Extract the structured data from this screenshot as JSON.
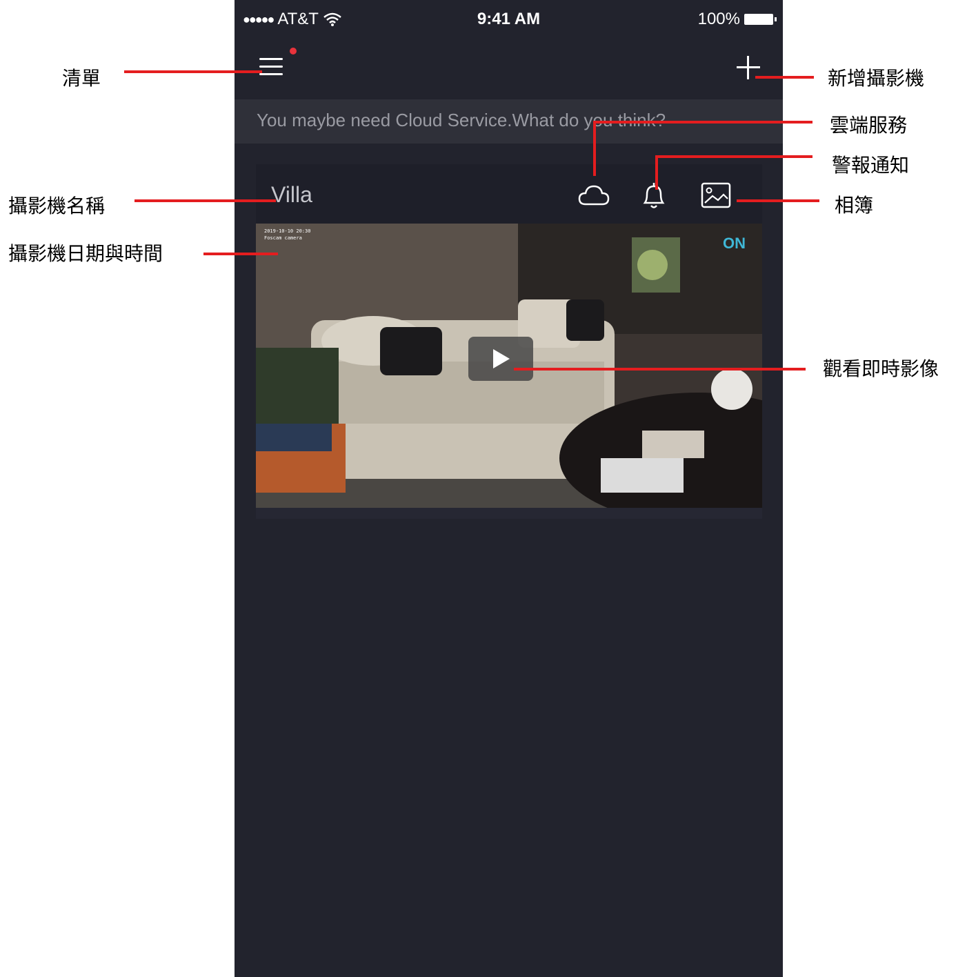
{
  "status_bar": {
    "signal_dots": "●●●●●",
    "carrier": "AT&T",
    "time": "9:41 AM",
    "battery_percent": "100%"
  },
  "navbar": {
    "menu_icon": "hamburger-menu-icon",
    "menu_badge_color": "#e8333c",
    "add_icon": "plus-icon"
  },
  "banner": {
    "text": "You maybe need Cloud Service.What do you think?"
  },
  "camera": {
    "name": "Villa",
    "overlay_date": "2019-10-10  20:30",
    "overlay_label": "Foscam camera",
    "status_badge": "ON",
    "icons": [
      "cloud-icon",
      "bell-icon",
      "album-icon"
    ],
    "play_icon": "play-icon"
  },
  "annotations": {
    "menu": "清單",
    "add_camera": "新增攝影機",
    "cloud_service": "雲端服務",
    "alert_notification": "警報通知",
    "album": "相簿",
    "camera_name": "攝影機名稱",
    "camera_datetime": "攝影機日期與時間",
    "live_view": "觀看即時影像"
  },
  "colors": {
    "background": "#22232d",
    "card": "#1e1f29",
    "banner": "#2f3039",
    "annotation_line": "#e41d1f",
    "on_badge": "#3fb7d6"
  }
}
